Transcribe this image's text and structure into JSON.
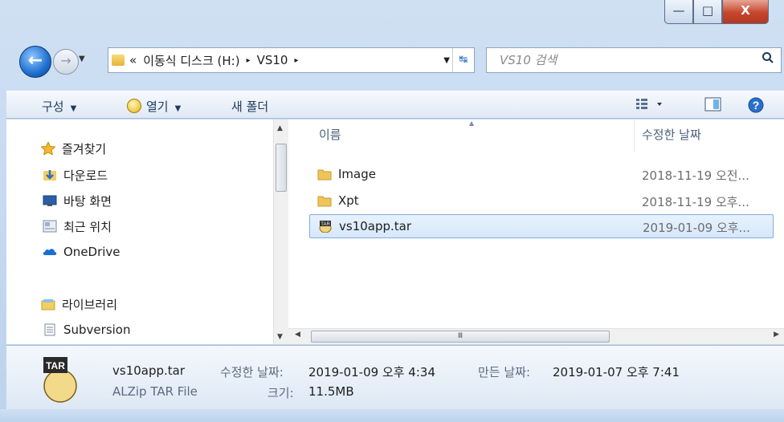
{
  "window": {
    "min_symbol": "—",
    "max_symbol": "□",
    "close_symbol": "X"
  },
  "address": {
    "overflow": "«",
    "crumbs": [
      "이동식 디스크 (H:)",
      "VS10"
    ],
    "separator": "▸"
  },
  "search": {
    "placeholder": "VS10 검색",
    "icon": "search-icon"
  },
  "toolbar": {
    "organize_label": "구성",
    "open_label": "열기",
    "new_folder_label": "새 폴더",
    "icons": [
      "view-options-icon",
      "preview-pane-icon",
      "help-icon"
    ]
  },
  "sidebar": {
    "items": [
      {
        "label": "즐겨찾기",
        "icon": "star-icon"
      },
      {
        "label": "다운로드",
        "icon": "downloads-folder-icon"
      },
      {
        "label": "바탕 화면",
        "icon": "desktop-icon"
      },
      {
        "label": "최근 위치",
        "icon": "recent-places-icon"
      },
      {
        "label": "OneDrive",
        "icon": "onedrive-cloud-icon"
      },
      {
        "label": "라이브러리",
        "icon": "library-icon"
      },
      {
        "label": "Subversion",
        "icon": "document-icon"
      }
    ]
  },
  "files": {
    "columns": [
      "이름",
      "수정한 날짜"
    ],
    "rows": [
      {
        "name": "Image",
        "date": "2018-11-19 오전...",
        "icon": "folder-icon"
      },
      {
        "name": "Xpt",
        "date": "2018-11-19 오후...",
        "icon": "folder-icon"
      },
      {
        "name": "vs10app.tar",
        "date": "2019-01-09 오후...",
        "icon": "tar-file-icon",
        "selected": true
      }
    ]
  },
  "details": {
    "file_name": "vs10app.tar",
    "file_type": "ALZip TAR File",
    "modified_label": "수정한 날짜:",
    "modified_value": "2019-01-09 오후 4:34",
    "created_label": "만든 날짜:",
    "created_value": "2019-01-07 오후 7:41",
    "size_label": "크기:",
    "size_value": "11.5MB",
    "icon_text": "TAR"
  },
  "colors": {
    "selection_border": "#84acdd",
    "accent": "#1f6fcf"
  }
}
